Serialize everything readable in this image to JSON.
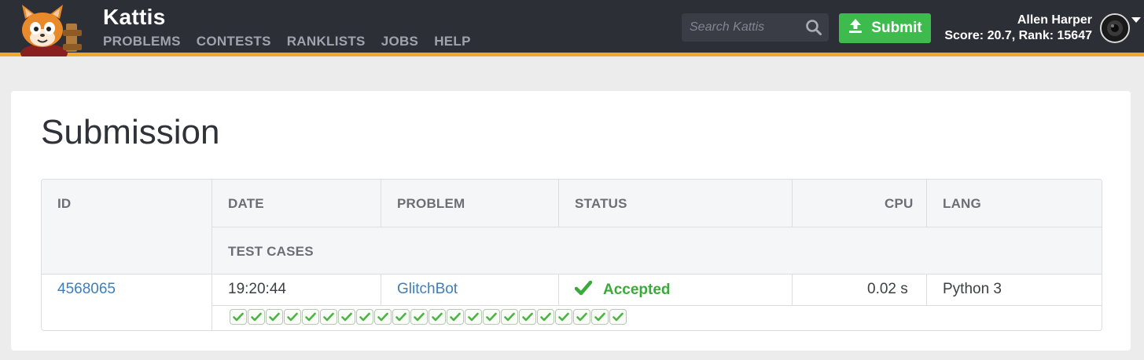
{
  "header": {
    "brand": "Kattis",
    "nav": [
      "PROBLEMS",
      "CONTESTS",
      "RANKLISTS",
      "JOBS",
      "HELP"
    ],
    "search_placeholder": "Search Kattis",
    "submit_label": "Submit",
    "user_name": "Allen Harper",
    "user_stats": "Score: 20.7, Rank: 15647"
  },
  "page": {
    "title": "Submission"
  },
  "table": {
    "headers": {
      "id": "ID",
      "date": "DATE",
      "problem": "PROBLEM",
      "status": "STATUS",
      "cpu": "CPU",
      "lang": "LANG",
      "test_cases": "TEST CASES"
    },
    "row": {
      "id": "4568065",
      "date": "19:20:44",
      "problem": "GlitchBot",
      "status": "Accepted",
      "cpu": "0.02 s",
      "lang": "Python 3"
    },
    "test_cases_passed": 22
  },
  "colors": {
    "header_bg": "#2d2f37",
    "accent": "#f0a92c",
    "submit_green": "#3dbb4d",
    "accepted_green": "#3aaa3a",
    "link_blue": "#3f7fb9"
  }
}
